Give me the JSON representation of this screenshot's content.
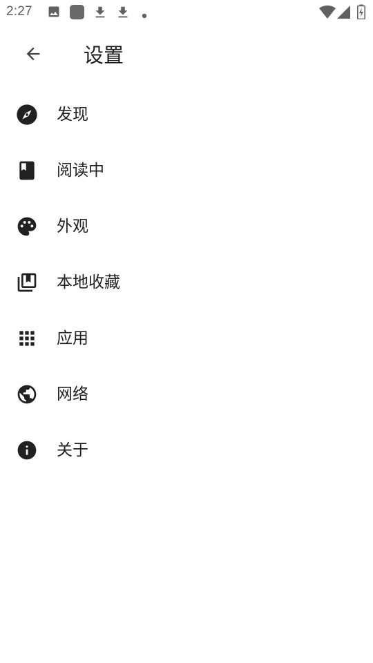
{
  "status_bar": {
    "time": "2:27",
    "icons": [
      "image-icon",
      "app-icon",
      "download-icon",
      "download-icon",
      "dot-icon",
      "wifi-icon",
      "signal-icon",
      "battery-charging-icon"
    ]
  },
  "app_bar": {
    "title": "设置",
    "back_icon": "arrow-back-icon"
  },
  "menu": {
    "items": [
      {
        "label": "发现",
        "icon": "compass-icon"
      },
      {
        "label": "阅读中",
        "icon": "book-icon"
      },
      {
        "label": "外观",
        "icon": "palette-icon"
      },
      {
        "label": "本地收藏",
        "icon": "library-bookmark-icon"
      },
      {
        "label": "应用",
        "icon": "apps-grid-icon"
      },
      {
        "label": "网络",
        "icon": "globe-icon"
      },
      {
        "label": "关于",
        "icon": "info-icon"
      }
    ]
  },
  "colors": {
    "icon": "#212121",
    "status_icon": "#616161",
    "background": "#ffffff"
  }
}
